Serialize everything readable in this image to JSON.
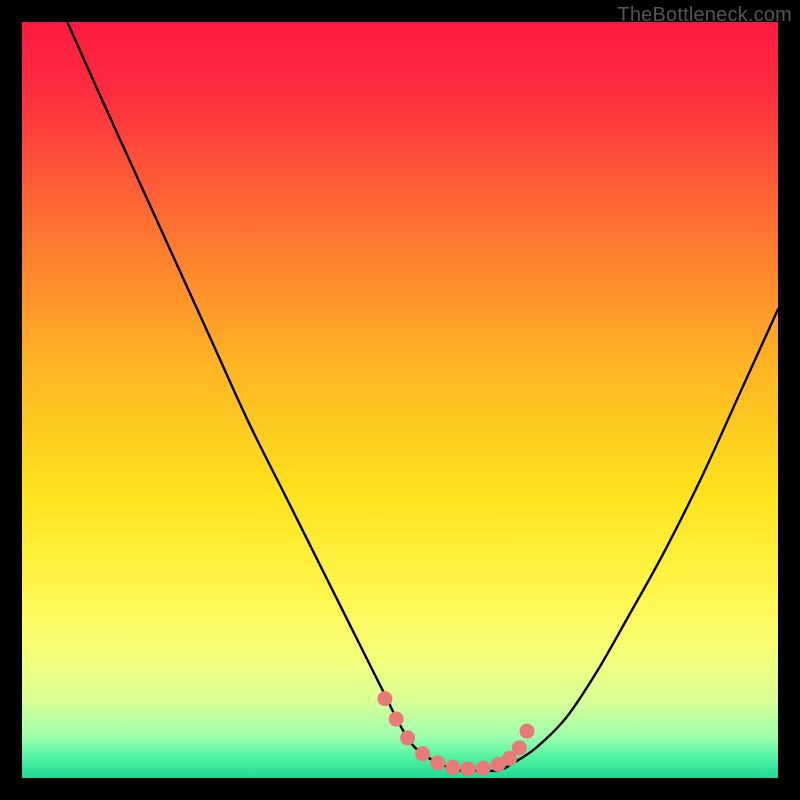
{
  "watermark": "TheBottleneck.com",
  "chart_data": {
    "type": "line",
    "title": "",
    "xlabel": "",
    "ylabel": "",
    "xlim": [
      0,
      100
    ],
    "ylim": [
      0,
      100
    ],
    "grid": false,
    "legend": false,
    "series": [
      {
        "name": "curve",
        "x": [
          6,
          10,
          15,
          20,
          25,
          30,
          35,
          40,
          45,
          48,
          50,
          52,
          55,
          58,
          60,
          63,
          65,
          68,
          72,
          76,
          80,
          85,
          90,
          95,
          100
        ],
        "values": [
          100,
          91,
          80,
          69,
          58,
          47,
          37,
          27,
          17,
          11,
          7,
          4,
          2,
          1,
          1,
          1,
          2,
          4,
          8,
          14,
          21,
          30,
          40,
          51,
          62
        ]
      }
    ],
    "markers": {
      "name": "red-dots",
      "x": [
        48.0,
        49.5,
        51.0,
        53.0,
        55.0,
        57.0,
        59.0,
        61.0,
        63.0,
        64.5,
        65.8,
        66.8
      ],
      "values": [
        10.5,
        7.8,
        5.3,
        3.2,
        2.0,
        1.4,
        1.2,
        1.3,
        1.8,
        2.6,
        4.0,
        6.2
      ]
    },
    "background_gradient": [
      {
        "offset": 0.0,
        "color": "#ff1a3f"
      },
      {
        "offset": 0.1,
        "color": "#ff2f3f"
      },
      {
        "offset": 0.25,
        "color": "#ff6a33"
      },
      {
        "offset": 0.45,
        "color": "#ffb324"
      },
      {
        "offset": 0.62,
        "color": "#ffe21b"
      },
      {
        "offset": 0.75,
        "color": "#fff64a"
      },
      {
        "offset": 0.84,
        "color": "#f6ff7a"
      },
      {
        "offset": 0.9,
        "color": "#d6ff97"
      },
      {
        "offset": 0.945,
        "color": "#9effad"
      },
      {
        "offset": 0.975,
        "color": "#4cf2a2"
      },
      {
        "offset": 1.0,
        "color": "#1fd894"
      }
    ]
  }
}
